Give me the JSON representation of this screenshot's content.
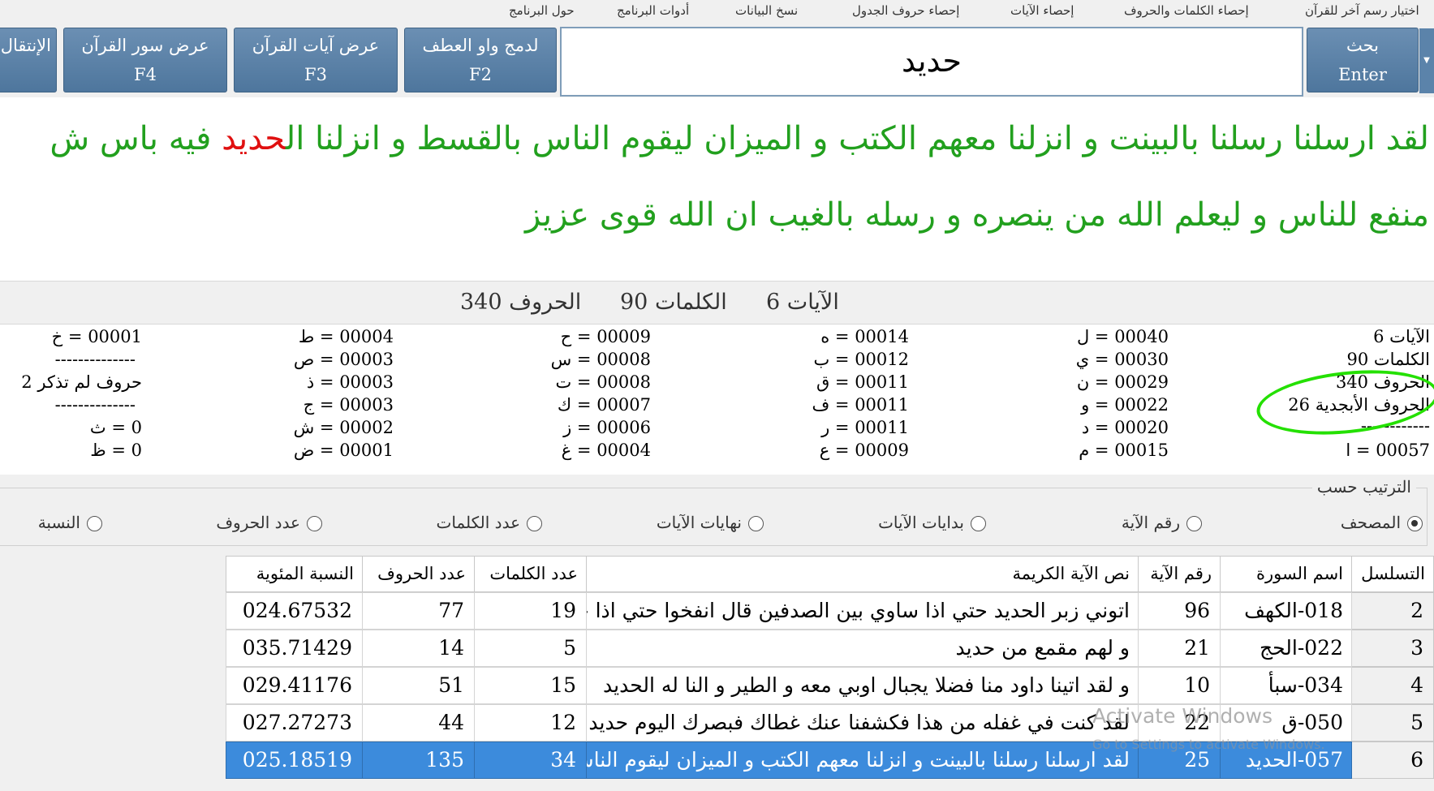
{
  "menu": {
    "items": [
      "اختيار رسم آخر للقرآن",
      "إحصاء الكلمات والحروف",
      "إحصاء الآيات",
      "إحصاء حروف الجدول",
      "نسخ البيانات",
      "أدوات البرنامج",
      "حول البرنامج"
    ]
  },
  "toolbar": {
    "search_btn": {
      "line1": "بحث",
      "line2": "Enter"
    },
    "merge_btn": {
      "line1": "لدمج واو العطف",
      "line2": "F2"
    },
    "ayat_btn": {
      "line1": "عرض آيات القرآن",
      "line2": "F3"
    },
    "suras_btn": {
      "line1": "عرض سور القرآن",
      "line2": "F4"
    },
    "goto_btn": {
      "line1": "الإنتقال"
    },
    "search_value": "حديد"
  },
  "verse": {
    "line1_before": "لقد ارسلنا رسلنا بالبينت و انزلنا معهم الكتب و الميزان ليقوم الناس بالقسط و انزلنا ال",
    "line1_highlight": "حديد",
    "line1_after": " فيه باس ش",
    "line2": "منفع للناس و ليعلم الله من ينصره و رسله بالغيب ان الله قوى عزيز"
  },
  "totals": {
    "ayat": "الآيات 6",
    "words": "الكلمات 90",
    "letters": "الحروف 340"
  },
  "stats": {
    "summary": [
      "الآيات 6",
      "الكلمات 90",
      "الحروف 340",
      "الحروف الأبجدية 26",
      "------------",
      "00057 = ا"
    ],
    "col2": [
      "00040 = ل",
      "00030 = ي",
      "00029 = ن",
      "00022 = و",
      "00020 = د",
      "00015 = م"
    ],
    "col3": [
      "00014 = ه",
      "00012 = ب",
      "00011 = ق",
      "00011 = ف",
      "00011 = ر",
      "00009 = ع"
    ],
    "col4": [
      "00009 = ح",
      "00008 = س",
      "00008 = ت",
      "00007 = ك",
      "00006 = ز",
      "00004 = غ"
    ],
    "col5": [
      "00004 = ط",
      "00003 = ص",
      "00003 = ذ",
      "00003 = ج",
      "00002 = ش",
      "00001 = ض"
    ],
    "col6": [
      "00001 = خ",
      "--------------",
      "حروف لم تذكر 2",
      "--------------",
      "0 = ث",
      "0 = ظ"
    ]
  },
  "sort": {
    "legend": "الترتيب حسب",
    "options": [
      "المصحف",
      "رقم الآية",
      "بدايات الآيات",
      "نهايات الآيات",
      "عدد الكلمات",
      "عدد الحروف",
      "النسبة"
    ],
    "selected": "المصحف"
  },
  "table": {
    "headers": [
      "التسلسل",
      "اسم السورة",
      "رقم الآية",
      "نص الآية الكريمة",
      "عدد الكلمات",
      "عدد الحروف",
      "النسبة المئوية"
    ],
    "rows": [
      {
        "seq": "2",
        "sura": "018-الكهف",
        "ayah": "96",
        "text": "اتوني زبر الحديد حتي اذا ساوي بين الصدفين قال انفخوا حتي اذا جعله",
        "words": "19",
        "letters": "77",
        "pct": "024.67532"
      },
      {
        "seq": "3",
        "sura": "022-الحج",
        "ayah": "21",
        "text": "و لهم مقمع من حديد",
        "words": "5",
        "letters": "14",
        "pct": "035.71429"
      },
      {
        "seq": "4",
        "sura": "034-سبأ",
        "ayah": "10",
        "text": "و لقد اتينا داود منا فضلا يجبال اوبي معه و الطير و النا له الحديد",
        "words": "15",
        "letters": "51",
        "pct": "029.41176"
      },
      {
        "seq": "5",
        "sura": "050-ق",
        "ayah": "22",
        "text": "لقد كنت في غفله من هذا فكشفنا عنك غطاك فبصرك اليوم حديد",
        "words": "12",
        "letters": "44",
        "pct": "027.27273"
      },
      {
        "seq": "6",
        "sura": "057-الحديد",
        "ayah": "25",
        "text": "لقد ارسلنا رسلنا بالبينت و انزلنا معهم الكتب و الميزان ليقوم الناس بالقسط",
        "words": "34",
        "letters": "135",
        "pct": "025.18519"
      }
    ]
  },
  "watermark": {
    "title": "Activate Windows",
    "sub": "Go to Settings to activate Windows."
  },
  "colors": {
    "verse_green": "#22a01e",
    "highlight_red": "#e01010",
    "button_blue": "#5b83aa",
    "selected_row": "#3c8bdc",
    "annotation_green": "#24e000"
  }
}
